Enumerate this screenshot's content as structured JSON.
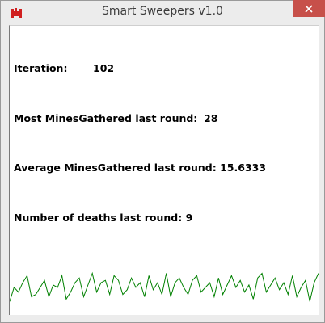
{
  "window": {
    "title": "Smart Sweepers v1.0",
    "accent_close": "#c7504a",
    "icon_color": "#d02020"
  },
  "stats": {
    "iteration_label": "Iteration:",
    "iteration_value": "102",
    "most_label": "Most MinesGathered last round:",
    "most_value": "28",
    "avg_label": "Average MinesGathered last round:",
    "avg_value": "15.6333",
    "deaths_label": "Number of deaths last round:",
    "deaths_value": "9"
  },
  "graph": {
    "line_color": "#008000",
    "series": [
      6,
      18,
      14,
      22,
      28,
      10,
      12,
      18,
      24,
      10,
      20,
      18,
      28,
      8,
      14,
      22,
      26,
      10,
      20,
      30,
      14,
      22,
      24,
      12,
      28,
      24,
      12,
      16,
      26,
      18,
      22,
      10,
      28,
      16,
      22,
      12,
      30,
      10,
      22,
      26,
      18,
      12,
      24,
      28,
      14,
      18,
      22,
      10,
      26,
      12,
      20,
      28,
      18,
      24,
      14,
      20,
      8,
      26,
      30,
      14,
      20,
      26,
      16,
      22,
      12,
      28,
      10,
      18,
      24,
      6,
      22,
      30
    ]
  }
}
